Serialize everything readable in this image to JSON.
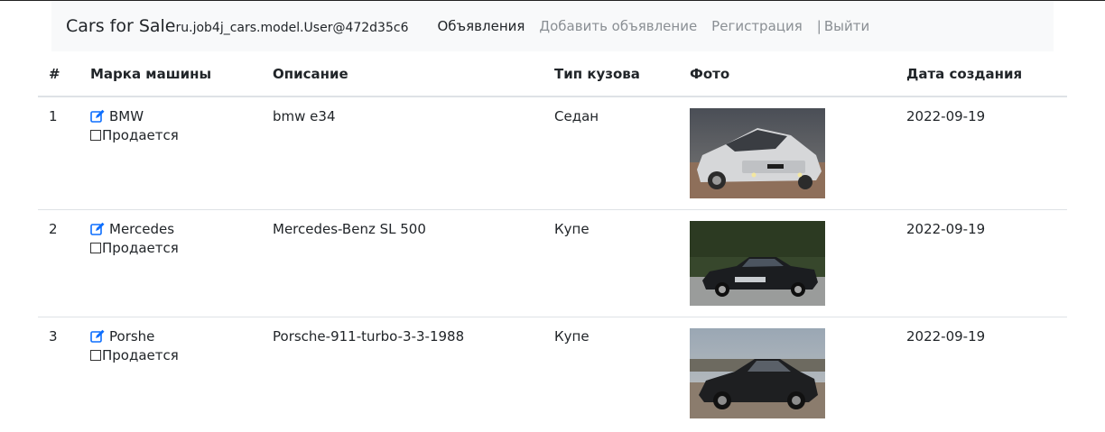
{
  "navbar": {
    "brand": "Cars for Sale",
    "user": "ru.job4j_cars.model.User@472d35c6",
    "links": [
      "Объявления",
      "Добавить объявление",
      "Регистрация"
    ],
    "separator": "|",
    "logout": "Выйти"
  },
  "table": {
    "headers": [
      "#",
      "Марка машины",
      "Описание",
      "Тип кузова",
      "Фото",
      "Дата создания"
    ],
    "sale_label": "Продается",
    "rows": [
      {
        "num": "1",
        "brand": "BMW",
        "description": "bmw e34",
        "body": "Седан",
        "date": "2022-09-19"
      },
      {
        "num": "2",
        "brand": "Mercedes",
        "description": "Mercedes-Benz SL 500",
        "body": "Купе",
        "date": "2022-09-19"
      },
      {
        "num": "3",
        "brand": "Porshe",
        "description": "Porsche-911-turbo-3-3-1988",
        "body": "Купе",
        "date": "2022-09-19"
      }
    ]
  },
  "colors": {
    "link": "#0d6efd",
    "muted": "#8a8f94",
    "navbar_bg": "#f8f9fa",
    "border": "#dee2e6"
  },
  "icons": [
    "edit-icon"
  ]
}
